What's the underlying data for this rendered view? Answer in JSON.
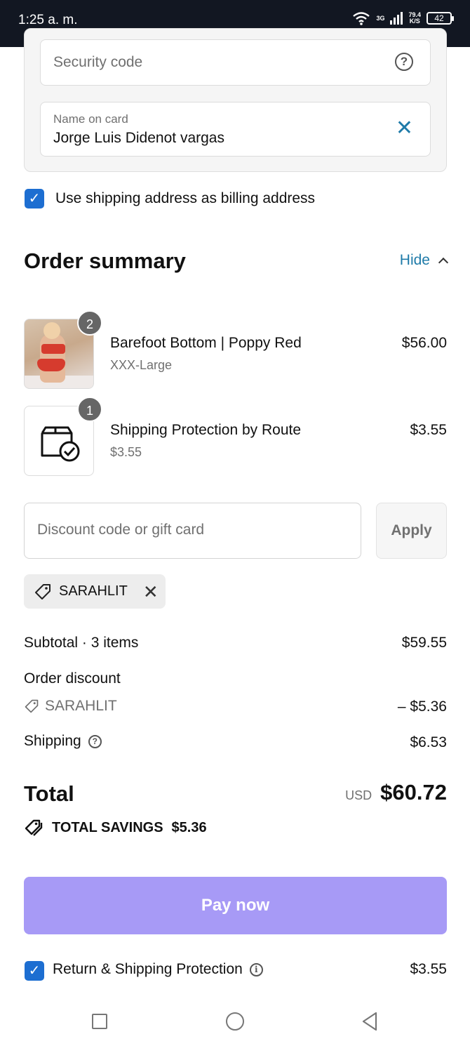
{
  "status_bar": {
    "time": "1:25 a. m.",
    "network": "3G",
    "speed_value": "79.4",
    "speed_unit": "K/S",
    "battery": "42"
  },
  "payment": {
    "security_code_placeholder": "Security code",
    "name_on_card_label": "Name on card",
    "name_on_card_value": "Jorge Luis Didenot vargas",
    "billing_same_label": "Use shipping address as billing address",
    "billing_same_checked": true
  },
  "order_summary": {
    "title": "Order summary",
    "toggle_label": "Hide",
    "items": [
      {
        "quantity": "2",
        "name": "Barefoot Bottom | Poppy Red",
        "variant": "XXX-Large",
        "price": "$56.00"
      },
      {
        "quantity": "1",
        "name": "Shipping Protection by Route",
        "variant": "$3.55",
        "price": "$3.55"
      }
    ]
  },
  "discount": {
    "placeholder": "Discount code or gift card",
    "apply_label": "Apply",
    "applied_code": "SARAHLIT"
  },
  "totals": {
    "subtotal_label": "Subtotal · 3 items",
    "subtotal_value": "$59.55",
    "order_discount_label": "Order discount",
    "discount_code": "SARAHLIT",
    "discount_value": "– $5.36",
    "shipping_label": "Shipping",
    "shipping_value": "$6.53",
    "total_label": "Total",
    "currency": "USD",
    "total_value": "$60.72",
    "savings_label": "TOTAL SAVINGS",
    "savings_value": "$5.36"
  },
  "actions": {
    "pay_label": "Pay now",
    "protection_label": "Return & Shipping Protection",
    "protection_price": "$3.55",
    "protection_checked": true
  },
  "colors": {
    "accent_link": "#1f7ba9",
    "checkbox": "#1d6ed1",
    "pay_button": "#a79af6",
    "status_bar": "#121722"
  }
}
